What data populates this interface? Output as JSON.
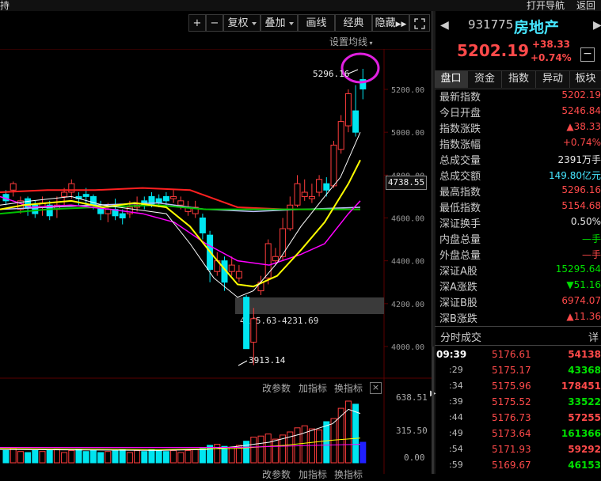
{
  "topbar": {
    "left_text": "持",
    "nav": "打开导航",
    "back": "返回"
  },
  "toolbar": {
    "plus": "+",
    "minus": "−",
    "fuquan": "复权",
    "diejia": "叠加",
    "huaxian": "画线",
    "jingdian": "经典",
    "yincang": "隐藏"
  },
  "chart": {
    "ma_setting": "设置均线",
    "price_axis": [
      "5200.00",
      "5000.00",
      "4800.00",
      "4600.00",
      "4400.00",
      "4200.00",
      "4000.00"
    ],
    "current_price_tag": "4738.55",
    "high_label": "5296.16",
    "low_label": "3913.14",
    "gap_label": "4145.63-4231.69",
    "colors": {
      "up": "#ff3c3c",
      "down": "#00e5f0",
      "ma5": "#ffffff",
      "ma10": "#ffff00",
      "ma20": "#ff00ff",
      "ma60": "#00c000",
      "ma120": "#c0c0ff",
      "ma250": "#ff2020",
      "circle": "#e020e0"
    }
  },
  "sub_chart": {
    "btn_params": "改参数",
    "btn_add": "加指标",
    "btn_switch": "换指标",
    "close": "×",
    "axis": [
      "638.51",
      "315.50",
      "0.00"
    ],
    "bottom_partial": [
      "改参数",
      "加指标",
      "换指标"
    ]
  },
  "stock": {
    "code": "931775",
    "name": "房地产",
    "price": "5202.19",
    "change": "+38.33",
    "change_pct": "+0.74%",
    "minus_btn": "−"
  },
  "tabs": [
    "盘口",
    "资金",
    "指数",
    "异动",
    "板块"
  ],
  "quote_rows": [
    {
      "label": "最新指数",
      "value": "5202.19",
      "color": "red"
    },
    {
      "label": "今日开盘",
      "value": "5246.84",
      "color": "red"
    },
    {
      "label": "指数涨跌",
      "value": "▲38.33",
      "color": "red"
    },
    {
      "label": "指数涨幅",
      "value": "+0.74%",
      "color": "red"
    },
    {
      "label": "总成交量",
      "value": "2391万手",
      "color": "white"
    },
    {
      "label": "总成交额",
      "value": "149.80亿元",
      "color": "cyan"
    },
    {
      "label": "最高指数",
      "value": "5296.16",
      "color": "red"
    },
    {
      "label": "最低指数",
      "value": "5154.68",
      "color": "red"
    },
    {
      "label": "深证换手",
      "value": "0.50%",
      "color": "white"
    },
    {
      "label": "内盘总量",
      "value": "—手",
      "color": "green"
    },
    {
      "label": "外盘总量",
      "value": "—手",
      "color": "red"
    },
    {
      "label": "深证A股",
      "value": "15295.64",
      "color": "green"
    },
    {
      "label": "深A涨跌",
      "value": "▼51.16",
      "color": "green"
    },
    {
      "label": "深证B股",
      "value": "6974.07",
      "color": "red"
    },
    {
      "label": "深B涨跌",
      "value": "▲11.36",
      "color": "red"
    }
  ],
  "ticks_header": {
    "title": "分时成交",
    "detail": "详"
  },
  "ticks": [
    {
      "time": "09:39",
      "price": "5176.61",
      "vol": "54138",
      "vcolor": "red"
    },
    {
      "time": ":29",
      "price": "5175.17",
      "vol": "43368",
      "vcolor": "green"
    },
    {
      "time": ":34",
      "price": "5175.96",
      "vol": "178451",
      "vcolor": "red"
    },
    {
      "time": ":39",
      "price": "5175.52",
      "vol": "33522",
      "vcolor": "green"
    },
    {
      "time": ":44",
      "price": "5176.73",
      "vol": "57255",
      "vcolor": "red"
    },
    {
      "time": ":49",
      "price": "5173.64",
      "vol": "161366",
      "vcolor": "green"
    },
    {
      "time": ":54",
      "price": "5171.93",
      "vol": "59292",
      "vcolor": "red"
    },
    {
      "time": ":59",
      "price": "5169.67",
      "vol": "46153",
      "vcolor": "green"
    }
  ]
}
